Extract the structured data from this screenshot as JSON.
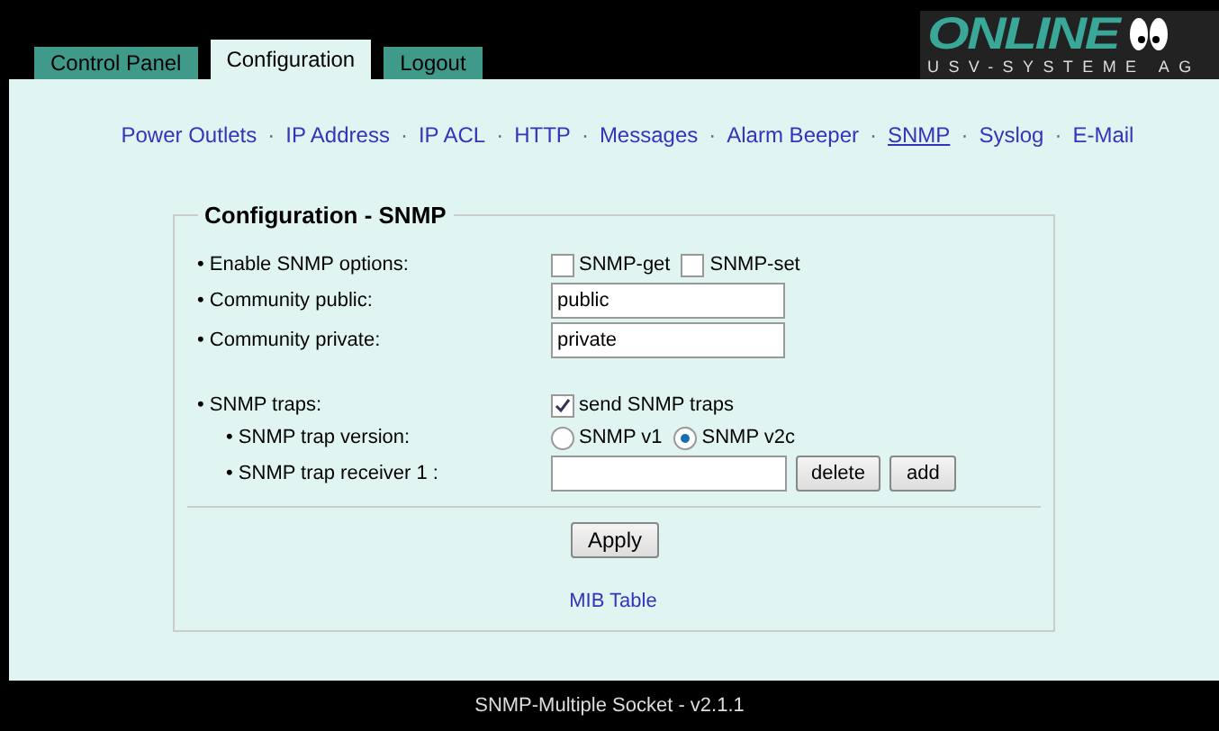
{
  "tabs": [
    {
      "label": "Control Panel",
      "selected": false
    },
    {
      "label": "Configuration",
      "selected": true
    },
    {
      "label": "Logout",
      "selected": false
    }
  ],
  "logo": {
    "name": "ONLINE",
    "tagline": "USV-SYSTEME AG"
  },
  "nav": {
    "separator": "·",
    "links": [
      {
        "label": "Power Outlets",
        "selected": false
      },
      {
        "label": "IP Address",
        "selected": false
      },
      {
        "label": "IP ACL",
        "selected": false
      },
      {
        "label": "HTTP",
        "selected": false
      },
      {
        "label": "Messages",
        "selected": false
      },
      {
        "label": "Alarm Beeper",
        "selected": false
      },
      {
        "label": "SNMP",
        "selected": true
      },
      {
        "label": "Syslog",
        "selected": false
      },
      {
        "label": "E-Mail",
        "selected": false
      }
    ]
  },
  "panel": {
    "title": "Configuration - SNMP",
    "rows": [
      {
        "kind": "checks",
        "label": "• Enable SNMP options:",
        "options": [
          {
            "label": "SNMP-get",
            "checked": false
          },
          {
            "label": "SNMP-set",
            "checked": false
          }
        ]
      },
      {
        "kind": "text",
        "label": "• Community public:",
        "value": "public"
      },
      {
        "kind": "text",
        "label": "• Community private:",
        "value": "private"
      },
      {
        "kind": "gap"
      },
      {
        "kind": "checks",
        "label": "• SNMP traps:",
        "options": [
          {
            "label": "send SNMP traps",
            "checked": true
          }
        ]
      },
      {
        "kind": "radios",
        "sub": true,
        "label": "• SNMP trap version:",
        "options": [
          {
            "label": "SNMP v1",
            "selected": false
          },
          {
            "label": "SNMP v2c",
            "selected": true
          }
        ]
      },
      {
        "kind": "receiver",
        "sub": true,
        "label": "• SNMP trap receiver 1 :",
        "buttons": [
          "delete",
          "add"
        ]
      }
    ],
    "apply": "Apply",
    "link": "MIB Table"
  },
  "footer": "SNMP-Multiple Socket - v2.1.1"
}
